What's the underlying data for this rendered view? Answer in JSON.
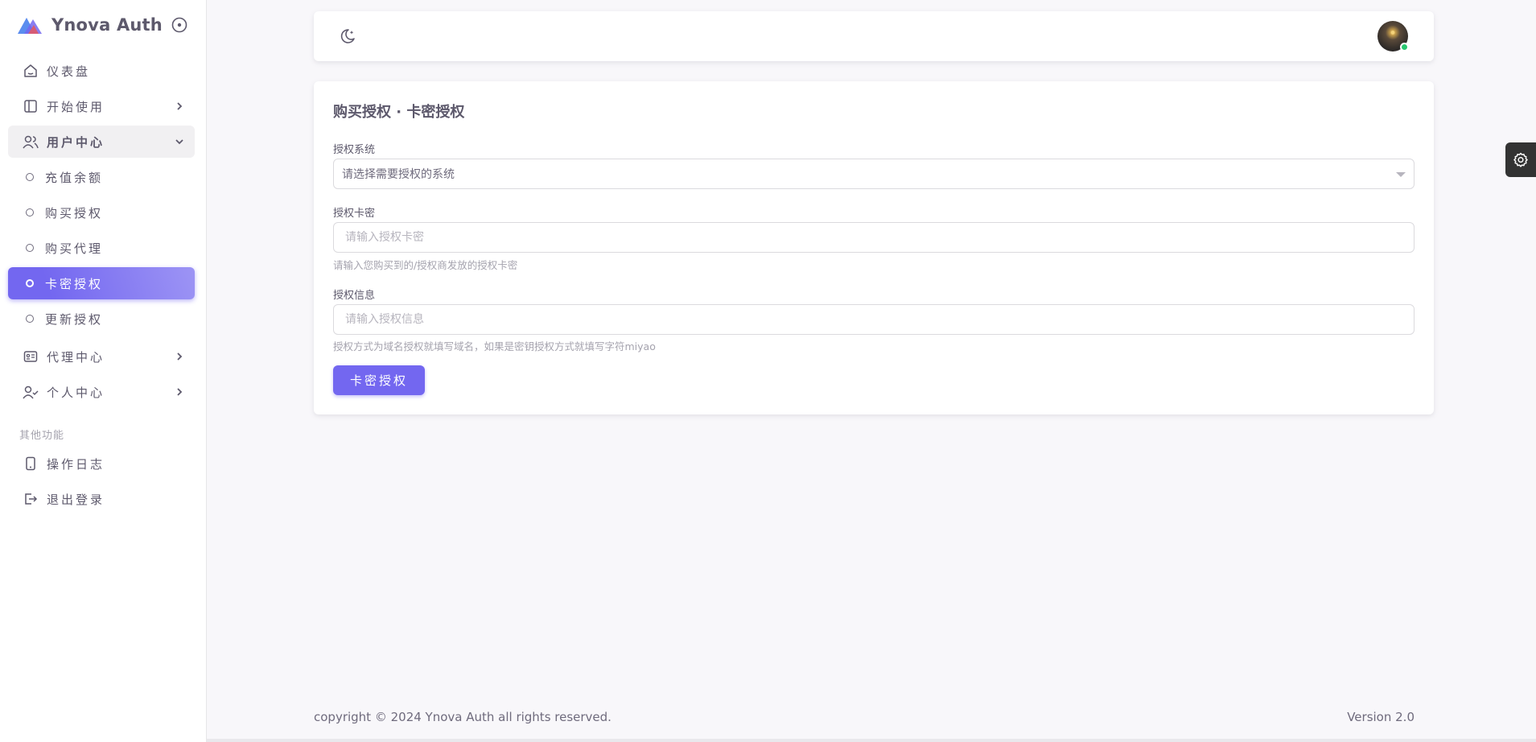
{
  "brand": {
    "name": "Ynova Auth"
  },
  "sidebar": {
    "items": [
      {
        "label": "仪表盘",
        "icon": "home-icon"
      },
      {
        "label": "开始使用",
        "icon": "layout-icon"
      },
      {
        "label": "用户中心",
        "icon": "users-icon"
      },
      {
        "label": "代理中心",
        "icon": "id-card-icon"
      },
      {
        "label": "个人中心",
        "icon": "user-check-icon"
      }
    ],
    "sub_items": [
      {
        "label": "充值余额"
      },
      {
        "label": "购买授权"
      },
      {
        "label": "购买代理"
      },
      {
        "label": "卡密授权"
      },
      {
        "label": "更新授权"
      }
    ],
    "other_header": "其他功能",
    "other_items": [
      {
        "label": "操作日志",
        "icon": "device-icon"
      },
      {
        "label": "退出登录",
        "icon": "logout-icon"
      }
    ]
  },
  "main": {
    "title": "购买授权 · 卡密授权",
    "system_label": "授权系统",
    "system_value": "请选择需要授权的系统",
    "card_label": "授权卡密",
    "card_placeholder": "请输入授权卡密",
    "card_help": "请输入您购买到的/授权商发放的授权卡密",
    "info_label": "授权信息",
    "info_placeholder": "请输入授权信息",
    "info_help": "授权方式为域名授权就填写域名，如果是密钥授权方式就填写字符miyao",
    "submit_label": "卡密授权"
  },
  "footer": {
    "copyright": "copyright © 2024 Ynova Auth all rights reserved.",
    "version": "Version 2.0"
  },
  "colors": {
    "primary": "#7367f0",
    "online": "#28c76f"
  }
}
